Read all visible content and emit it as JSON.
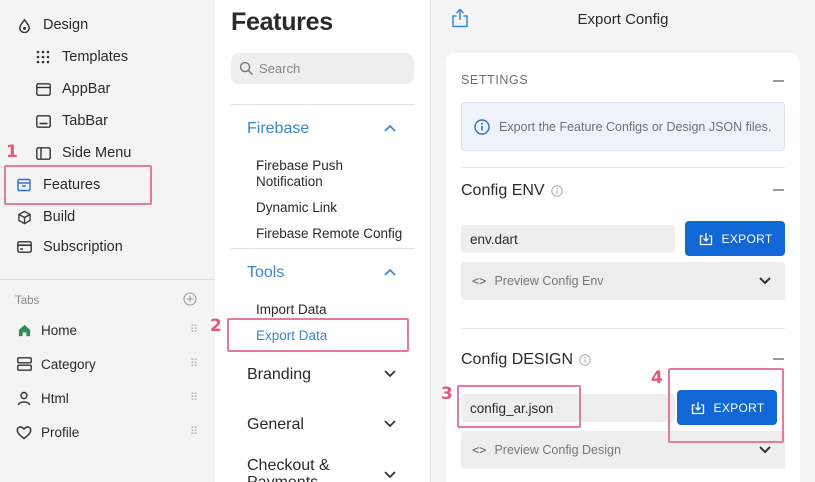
{
  "sidebar": {
    "items": [
      {
        "label": "Design",
        "icon": "palette-icon"
      },
      {
        "label": "Templates",
        "icon": "grid-dots-icon"
      },
      {
        "label": "AppBar",
        "icon": "appbar-icon"
      },
      {
        "label": "TabBar",
        "icon": "tabbar-icon"
      },
      {
        "label": "Side Menu",
        "icon": "side-menu-icon"
      },
      {
        "label": "Features",
        "icon": "archive-icon"
      },
      {
        "label": "Build",
        "icon": "cube-icon"
      },
      {
        "label": "Subscription",
        "icon": "credit-card-icon"
      }
    ],
    "tabs_heading": "Tabs",
    "tabs": [
      {
        "label": "Home",
        "icon": "home-icon"
      },
      {
        "label": "Category",
        "icon": "category-icon"
      },
      {
        "label": "Html",
        "icon": "user-icon"
      },
      {
        "label": "Profile",
        "icon": "heart-icon"
      }
    ]
  },
  "middle": {
    "title": "Features",
    "search_placeholder": "Search",
    "sections": [
      {
        "label": "Firebase",
        "expanded": true,
        "items": [
          "Firebase Push Notification",
          "Dynamic Link",
          "Firebase Remote Config"
        ]
      },
      {
        "label": "Tools",
        "expanded": true,
        "items": [
          "Import Data",
          "Export Data"
        ]
      },
      {
        "label": "Branding",
        "expanded": false
      },
      {
        "label": "General",
        "expanded": false
      },
      {
        "label": "Checkout & Payments",
        "expanded": false
      }
    ]
  },
  "right": {
    "header_title": "Export Config",
    "settings_label": "SETTINGS",
    "info_text": "Export the Feature Configs or Design JSON files.",
    "env": {
      "title": "Config ENV",
      "field_value": "env.dart",
      "export_label": "EXPORT",
      "preview_label": "Preview Config Env"
    },
    "design": {
      "title": "Config DESIGN",
      "field_value": "config_ar.json",
      "export_label": "EXPORT",
      "preview_label": "Preview Config Design"
    }
  },
  "annotations": [
    "1",
    "2",
    "3",
    "4"
  ],
  "colors": {
    "accent": "#1267d6",
    "link_blue": "#3a86d4",
    "annotation_pink": "#e57aa0",
    "sidebar_bg": "#f4f4f4"
  }
}
